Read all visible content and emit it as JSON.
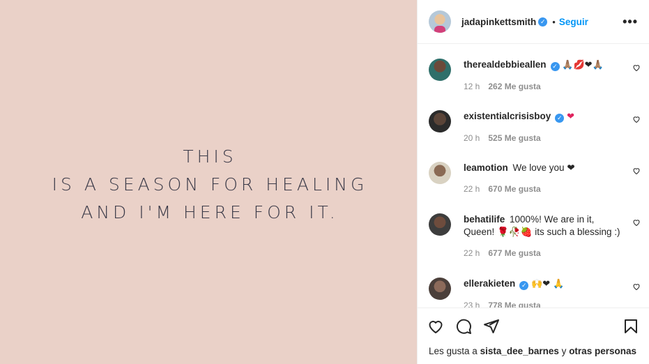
{
  "media": {
    "quote_lines": [
      "THIS",
      "IS A SEASON FOR HEALING",
      "AND I'M HERE FOR IT."
    ]
  },
  "header": {
    "username": "jadapinkettsmith",
    "verified": true,
    "separator": "•",
    "follow_label": "Seguir",
    "more_label": "•••"
  },
  "comments": [
    {
      "username": "therealdebbieallen",
      "verified": true,
      "text": "🙏🏽💋❤🙏🏽",
      "time": "12 h",
      "likes": "262 Me gusta"
    },
    {
      "username": "existentialcrisisboy",
      "verified": true,
      "text": "❤",
      "time": "20 h",
      "likes": "525 Me gusta"
    },
    {
      "username": "leamotion",
      "verified": false,
      "text": "We love you ❤",
      "time": "22 h",
      "likes": "670 Me gusta"
    },
    {
      "username": "behatilife",
      "verified": false,
      "text": "1000%! We are in it, Queen! 🌹🥀🍓 its such a blessing :)",
      "time": "22 h",
      "likes": "677 Me gusta"
    },
    {
      "username": "ellerakieten",
      "verified": true,
      "text": "🙌❤ 🙏",
      "time": "23 h",
      "likes": "778 Me gusta"
    }
  ],
  "actions": {
    "icons": [
      "heart-icon",
      "comment-icon",
      "share-icon",
      "bookmark-icon"
    ]
  },
  "likes_summary": {
    "prefix": "Les gusta a",
    "user": "sista_dee_barnes",
    "joiner": "y",
    "others": "otras personas"
  },
  "colors": {
    "media_bg": "#ead1c8",
    "quote_text": "#3b3a48",
    "follow_blue": "#0095f6",
    "verified_blue": "#3897f0",
    "meta_gray": "#8e8e8e"
  }
}
